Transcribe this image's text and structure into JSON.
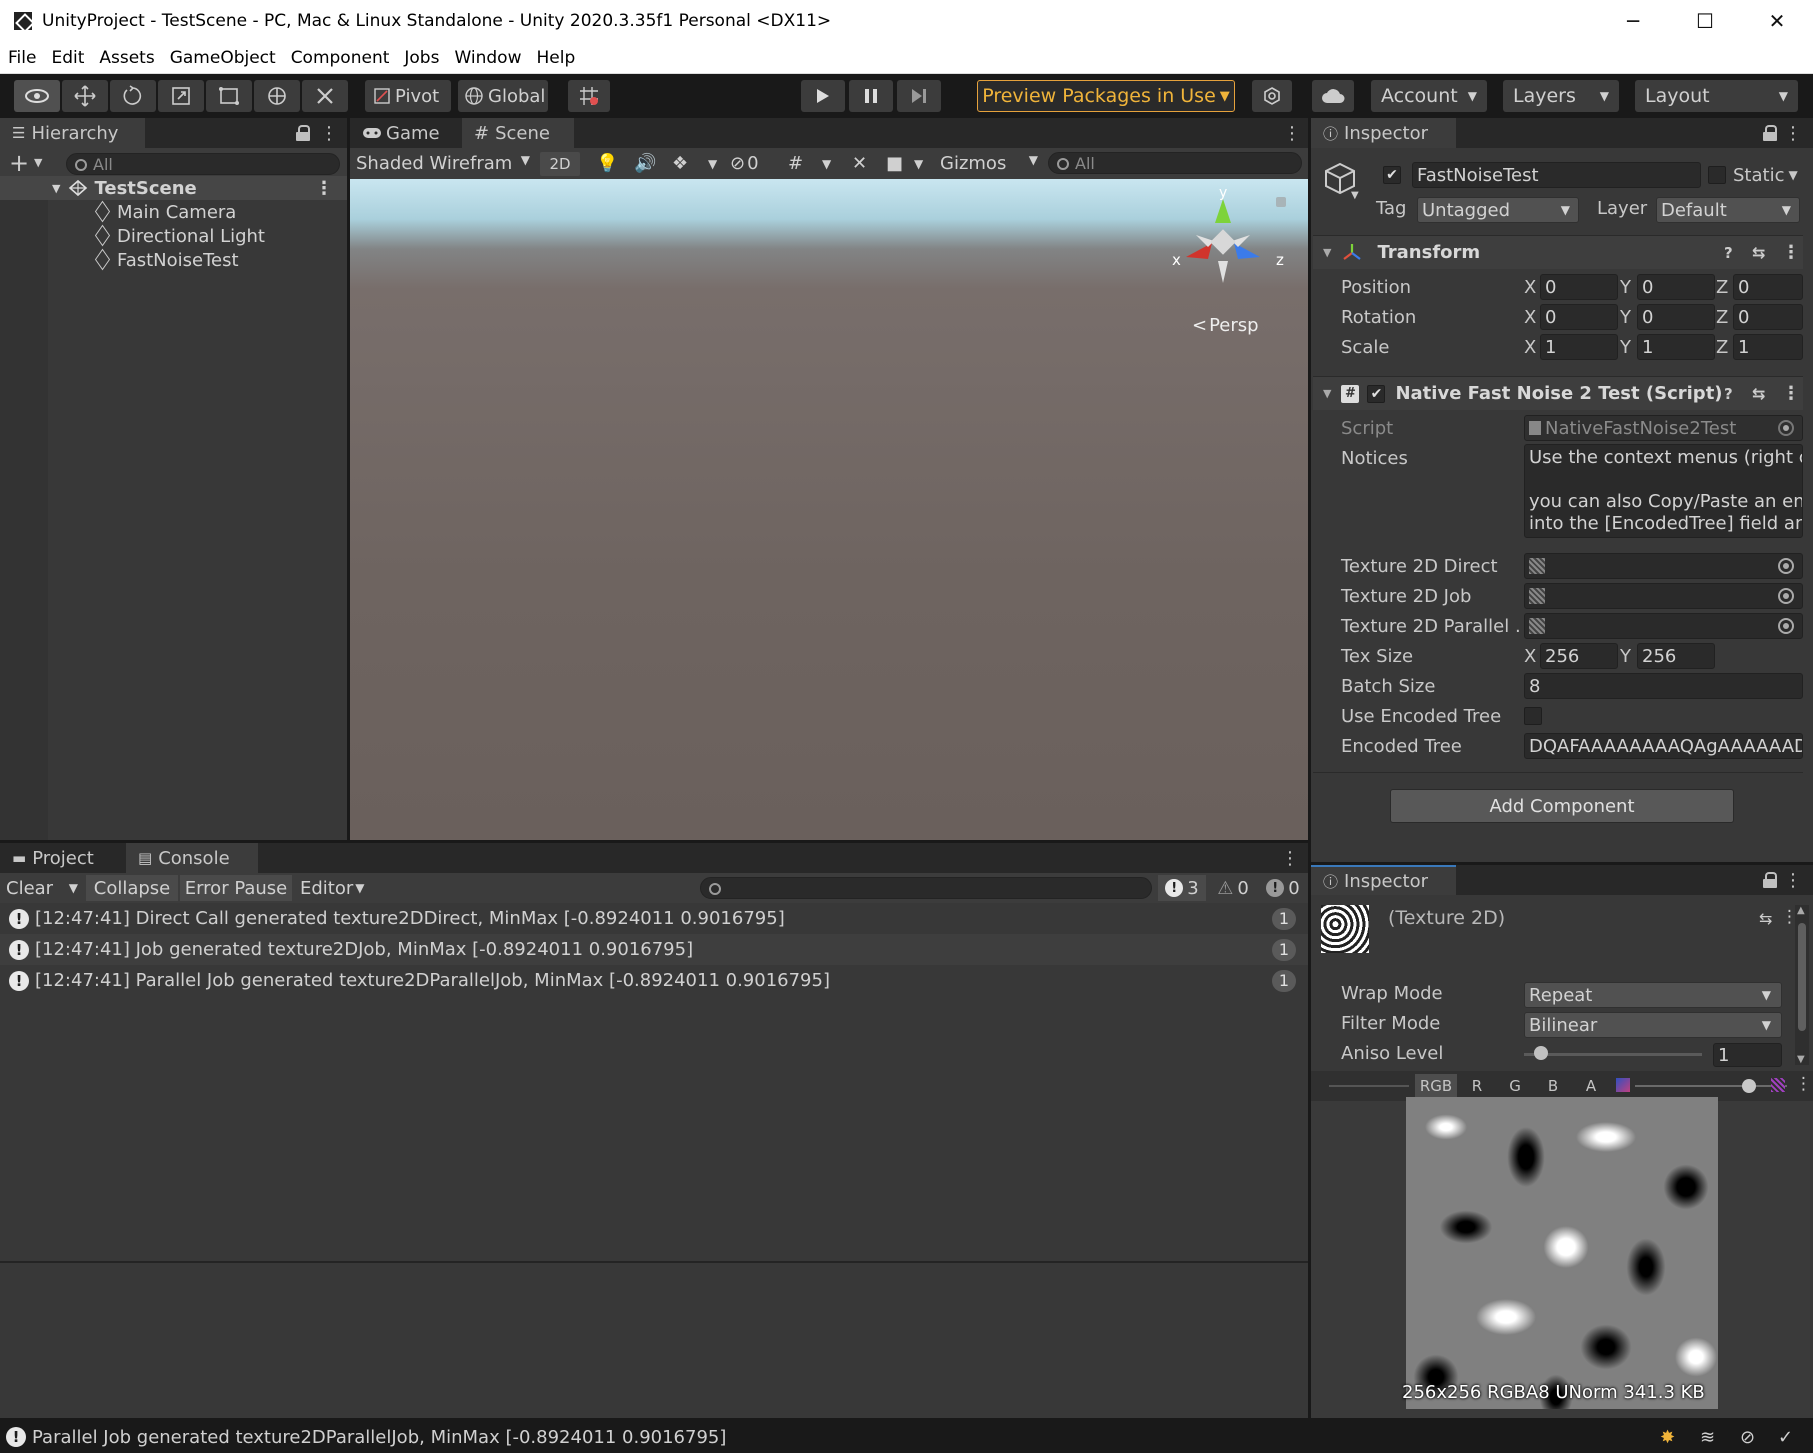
{
  "window": {
    "title": "UnityProject - TestScene - PC, Mac & Linux Standalone - Unity 2020.3.35f1 Personal <DX11>",
    "controls": [
      "─",
      "☐",
      "✕"
    ]
  },
  "menu": [
    "File",
    "Edit",
    "Assets",
    "GameObject",
    "Component",
    "Jobs",
    "Window",
    "Help"
  ],
  "toolbar": {
    "pivot": "Pivot",
    "global": "Global",
    "preview_packages": "Preview Packages in Use",
    "account": "Account",
    "layers": "Layers",
    "layout": "Layout"
  },
  "hierarchy": {
    "tab": "Hierarchy",
    "search_placeholder": "All",
    "scene": "TestScene",
    "items": [
      "Main Camera",
      "Directional Light",
      "FastNoiseTest"
    ]
  },
  "scene_panel": {
    "tabs": [
      "Game",
      "Scene"
    ],
    "shading": "Shaded Wirefram",
    "mode_2d": "2D",
    "hidden_count": "0",
    "gizmos": "Gizmos",
    "search_placeholder": "All",
    "axis_y": "y",
    "axis_x": "x",
    "axis_z": "z",
    "persp": "Persp"
  },
  "console": {
    "tabs": [
      "Project",
      "Console"
    ],
    "clear": "Clear",
    "collapse": "Collapse",
    "error_pause": "Error Pause",
    "editor": "Editor",
    "counts": {
      "info": "3",
      "warn": "0",
      "error": "0"
    },
    "rows": [
      {
        "text": "[12:47:41] Direct Call generated texture2DDirect, MinMax [-0.8924011 0.9016795]",
        "count": "1"
      },
      {
        "text": "[12:47:41] Job generated texture2DJob, MinMax [-0.8924011 0.9016795]",
        "count": "1"
      },
      {
        "text": "[12:47:41] Parallel Job generated texture2DParallelJob, MinMax [-0.8924011 0.9016795]",
        "count": "1"
      }
    ]
  },
  "inspector": {
    "tab": "Inspector",
    "object_name": "FastNoiseTest",
    "static": "Static",
    "tag_label": "Tag",
    "tag_value": "Untagged",
    "layer_label": "Layer",
    "layer_value": "Default",
    "transform": {
      "title": "Transform",
      "rows": [
        {
          "label": "Position",
          "x": "0",
          "y": "0",
          "z": "0"
        },
        {
          "label": "Rotation",
          "x": "0",
          "y": "0",
          "z": "0"
        },
        {
          "label": "Scale",
          "x": "1",
          "y": "1",
          "z": "1"
        }
      ]
    },
    "script_comp": {
      "title": "Native Fast Noise 2 Test (Script)",
      "script_label": "Script",
      "script_value": "NativeFastNoise2Test",
      "notices_label": "Notices",
      "notices_lines": [
        "Use the context menus (right cl",
        "",
        "you can also Copy/Paste an en",
        "into the [EncodedTree] field an"
      ],
      "tex_direct_label": "Texture 2D Direct",
      "tex_job_label": "Texture 2D Job",
      "tex_parallel_label": "Texture 2D Parallel .",
      "tex_size_label": "Tex Size",
      "tex_size_x": "256",
      "tex_size_y": "256",
      "batch_label": "Batch Size",
      "batch_value": "8",
      "use_encoded_label": "Use Encoded Tree",
      "encoded_label": "Encoded Tree",
      "encoded_value": "DQAFAAAAAAAAQAgAAAAAAD"
    },
    "add_component": "Add Component"
  },
  "inspector2": {
    "tab": "Inspector",
    "title": "(Texture 2D)",
    "wrap_label": "Wrap Mode",
    "wrap_value": "Repeat",
    "filter_label": "Filter Mode",
    "filter_value": "Bilinear",
    "aniso_label": "Aniso Level",
    "aniso_value": "1",
    "channels": [
      "RGB",
      "R",
      "G",
      "B",
      "A"
    ],
    "preview_info": "256x256  RGBA8 UNorm  341.3 KB"
  },
  "status": {
    "message": "Parallel Job generated texture2DParallelJob, MinMax [-0.8924011 0.9016795]"
  },
  "colors": {
    "accent_warning": "#f0b43a",
    "panel": "#383838",
    "dark": "#191919"
  }
}
